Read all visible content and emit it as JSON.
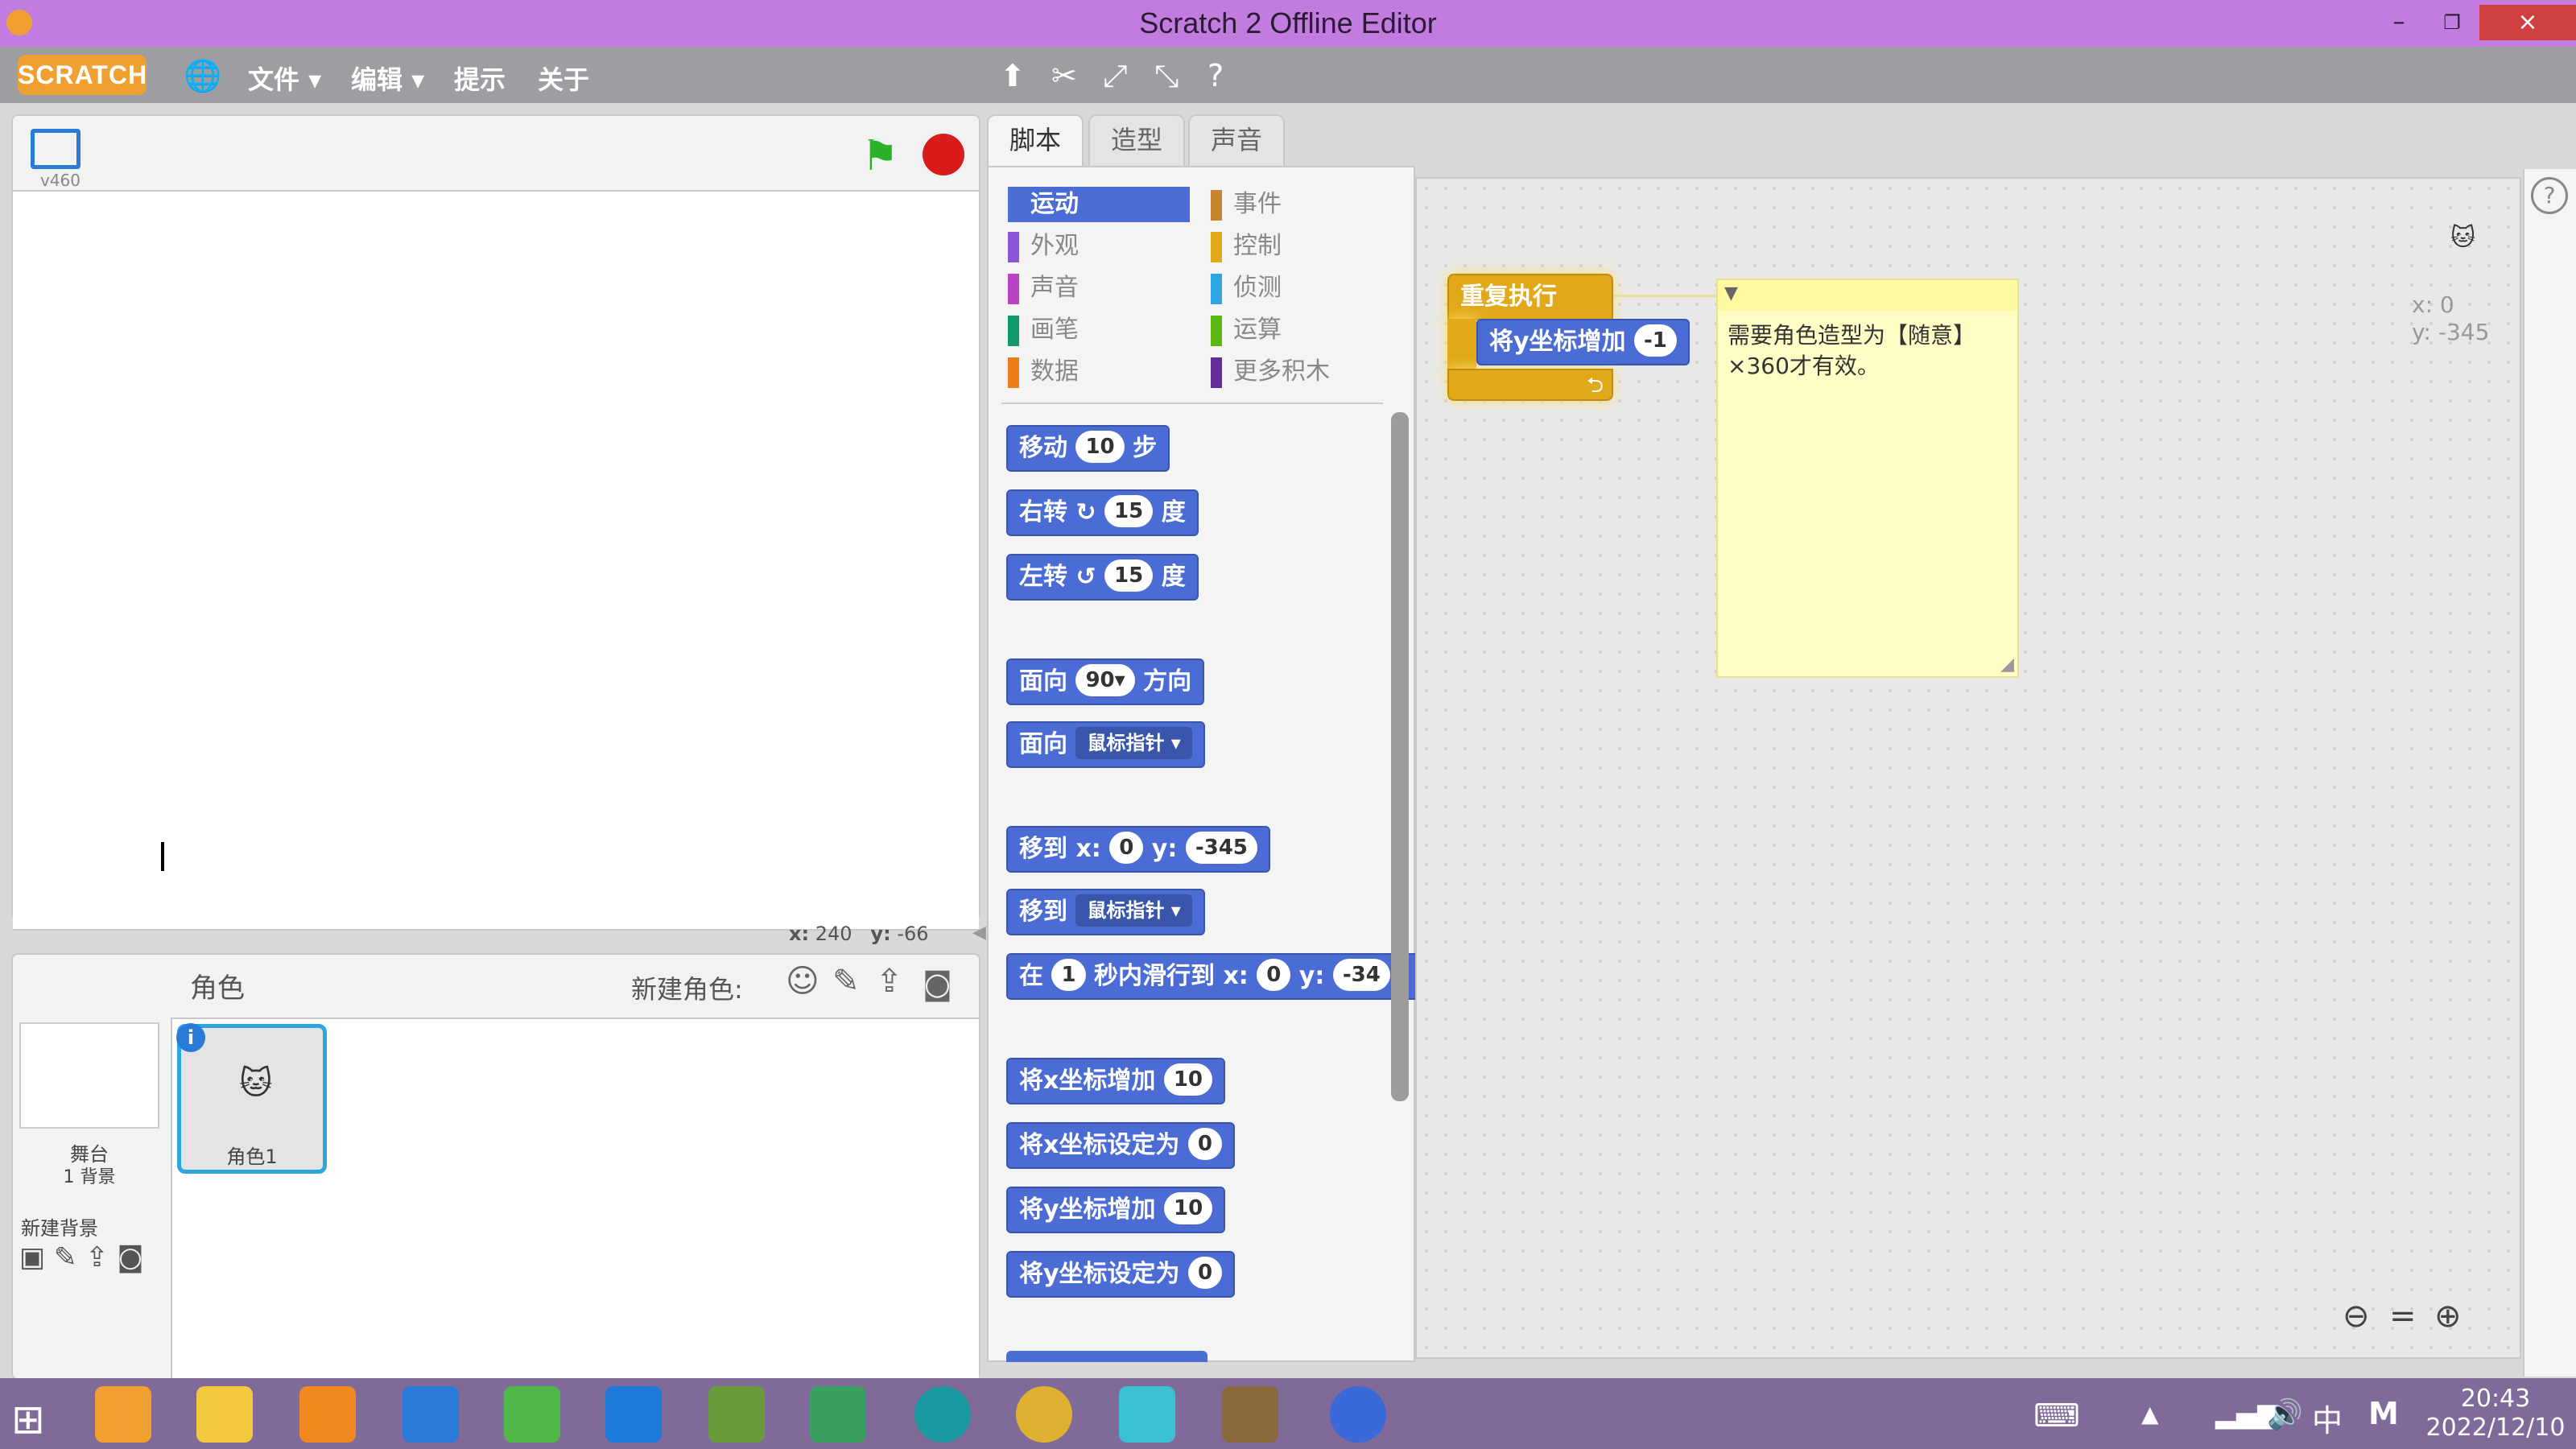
{
  "window": {
    "title": "Scratch 2 Offline Editor",
    "minimize": "–",
    "restore": "❐",
    "close": "×"
  },
  "menu": {
    "logo": "SCRATCH",
    "file": "文件 ▾",
    "edit": "编辑 ▾",
    "tips": "提示",
    "about": "关于"
  },
  "stage": {
    "version": "v460",
    "coords_x_label": "x:",
    "coords_x": "240",
    "coords_y_label": "y:",
    "coords_y": "-66"
  },
  "sprites": {
    "title": "角色",
    "new_sprite_label": "新建角色:",
    "stage_label": "舞台",
    "stage_backdrops": "1 背景",
    "new_backdrop": "新建背景",
    "sprite1": "角色1"
  },
  "tabs": [
    "脚本",
    "造型",
    "声音"
  ],
  "categories": [
    {
      "label": "运动",
      "color": "#4a6cd4"
    },
    {
      "label": "事件",
      "color": "#c88330"
    },
    {
      "label": "外观",
      "color": "#8a55d7"
    },
    {
      "label": "控制",
      "color": "#e1a91a"
    },
    {
      "label": "声音",
      "color": "#bb42c3"
    },
    {
      "label": "侦测",
      "color": "#2ca5e2"
    },
    {
      "label": "画笔",
      "color": "#0e9a6c"
    },
    {
      "label": "运算",
      "color": "#5cb712"
    },
    {
      "label": "数据",
      "color": "#ee7d16"
    },
    {
      "label": "更多积木",
      "color": "#632d99"
    }
  ],
  "blocks": {
    "move": {
      "a": "移动",
      "v": "10",
      "b": "步"
    },
    "turn_right": {
      "a": "右转",
      "icon": "↻",
      "v": "15",
      "b": "度"
    },
    "turn_left": {
      "a": "左转",
      "icon": "↺",
      "v": "15",
      "b": "度"
    },
    "point_dir": {
      "a": "面向",
      "v": "90▾",
      "b": "方向"
    },
    "point_towards": {
      "a": "面向",
      "v": "鼠标指针 ▾"
    },
    "goto_xy": {
      "a": "移到 x:",
      "x": "0",
      "b": "y:",
      "y": "-345"
    },
    "goto": {
      "a": "移到",
      "v": "鼠标指针 ▾"
    },
    "glide": {
      "a": "在",
      "v": "1",
      "b": "秒内滑行到 x:",
      "x": "0",
      "c": "y:",
      "y": "-34"
    },
    "change_x": {
      "a": "将x坐标增加",
      "v": "10"
    },
    "set_x": {
      "a": "将x坐标设定为",
      "v": "0"
    },
    "change_y": {
      "a": "将y坐标增加",
      "v": "10"
    },
    "set_y": {
      "a": "将y坐标设定为",
      "v": "0"
    }
  },
  "script": {
    "forever": "重复执行",
    "inner": "将y坐标增加",
    "inner_value": "-1"
  },
  "comment": {
    "text": "需要角色造型为【随意】×360才有效。"
  },
  "sprite_info": {
    "x": "x: 0",
    "y": "y: -345"
  },
  "taskbar": {
    "time": "20:43",
    "date": "2022/12/10",
    "ime": "中",
    "ime2": "M"
  },
  "colors": {
    "titlebar": "#c27ce0",
    "menubar": "#9c9ea2",
    "motion": "#4a6cd4",
    "control": "#e1a91a",
    "taskbar": "#7f6a9a"
  }
}
